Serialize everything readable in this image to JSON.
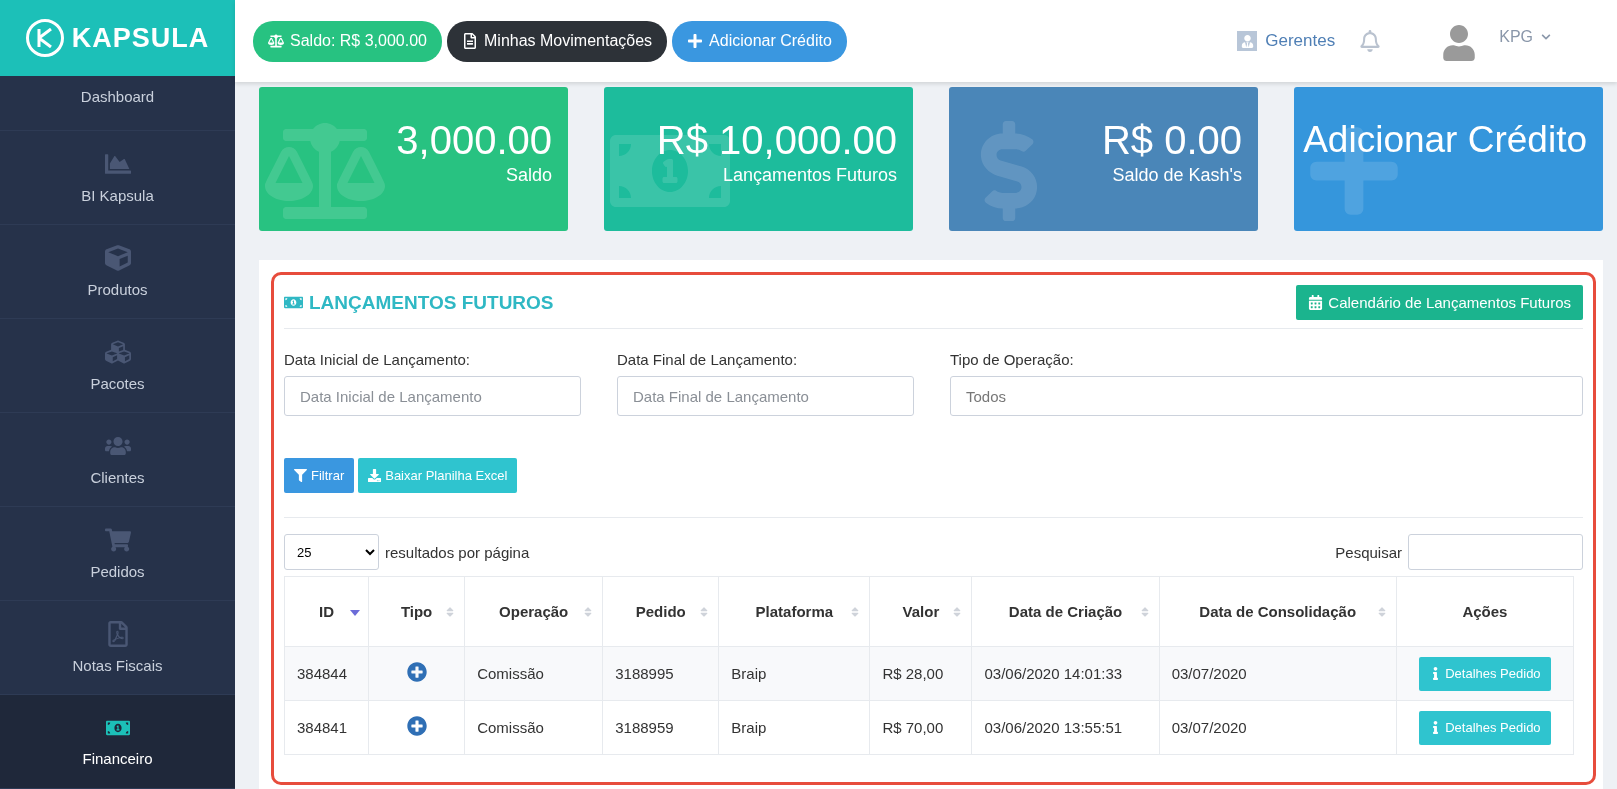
{
  "brand": {
    "name": "KAPSULA"
  },
  "topbar": {
    "pills": [
      {
        "kind": "balance",
        "label": "Saldo: R$ 3,000.00"
      },
      {
        "kind": "statement",
        "label": "Minhas Movimentações"
      },
      {
        "kind": "add",
        "label": "Adicionar Crédito"
      }
    ],
    "managers_link": "Gerentes",
    "user": "KPG"
  },
  "sidebar": {
    "items": [
      {
        "kind": "dashboard",
        "label": "Dashboard",
        "selected": false
      },
      {
        "kind": "bi",
        "label": "BI Kapsula",
        "selected": false
      },
      {
        "kind": "products",
        "label": "Produtos",
        "selected": false
      },
      {
        "kind": "packages",
        "label": "Pacotes",
        "selected": false
      },
      {
        "kind": "clients",
        "label": "Clientes",
        "selected": false
      },
      {
        "kind": "orders",
        "label": "Pedidos",
        "selected": false
      },
      {
        "kind": "invoices",
        "label": "Notas Fiscais",
        "selected": false
      },
      {
        "kind": "finance",
        "label": "Financeiro",
        "selected": true
      }
    ]
  },
  "cards": [
    {
      "kind": "balance",
      "value": "3,000.00",
      "label": "Saldo",
      "color": "#28c281"
    },
    {
      "kind": "future",
      "value": "R$ 10,000.00",
      "label": "Lançamentos Futuros",
      "color": "#1dbc9c"
    },
    {
      "kind": "kash",
      "value": "R$ 0.00",
      "label": "Saldo de Kash's",
      "color": "#4a86b8"
    },
    {
      "kind": "add",
      "value": "Adicionar Crédito",
      "color": "#3596dc"
    }
  ],
  "section": {
    "title": "LANÇAMENTOS FUTUROS",
    "calendar_button": "Calendário de Lançamentos Futuros",
    "filters": [
      {
        "label": "Data Inicial de Lançamento:",
        "placeholder": "Data Inicial de Lançamento"
      },
      {
        "label": "Data Final de Lançamento:",
        "placeholder": "Data Final de Lançamento"
      },
      {
        "label": "Tipo de Operação:",
        "value": "Todos"
      }
    ],
    "buttons": [
      {
        "kind": "filter",
        "label": "Filtrar"
      },
      {
        "kind": "download",
        "label": "Baixar Planilha Excel"
      }
    ],
    "page_size": "25",
    "page_size_label": "resultados por página",
    "search_label": "Pesquisar"
  },
  "table": {
    "columns": [
      {
        "label": "ID",
        "sortable": true,
        "sorted": true
      },
      {
        "label": "Tipo",
        "sortable": true,
        "sorted": false
      },
      {
        "label": "Operação",
        "sortable": true,
        "sorted": false
      },
      {
        "label": "Pedido",
        "sortable": true,
        "sorted": false
      },
      {
        "label": "Plataforma",
        "sortable": true,
        "sorted": false
      },
      {
        "label": "Valor",
        "sortable": true,
        "sorted": false
      },
      {
        "label": "Data de Criação",
        "sortable": true,
        "sorted": false
      },
      {
        "label": "Data de Consolidação",
        "sortable": true,
        "sorted": false
      },
      {
        "label": "Ações",
        "sortable": false
      }
    ],
    "rows": [
      {
        "id": "384844",
        "credit": true,
        "operacao": "Comissão",
        "pedido": "3188995",
        "plataforma": "Braip",
        "valor": "R$ 28,00",
        "criacao": "03/06/2020 14:01:33",
        "consolidacao": "03/07/2020",
        "action": "Detalhes Pedido"
      },
      {
        "id": "384841",
        "credit": true,
        "operacao": "Comissão",
        "pedido": "3188959",
        "plataforma": "Braip",
        "valor": "R$ 70,00",
        "criacao": "03/06/2020 13:55:51",
        "consolidacao": "03/07/2020",
        "action": "Detalhes Pedido"
      }
    ]
  }
}
